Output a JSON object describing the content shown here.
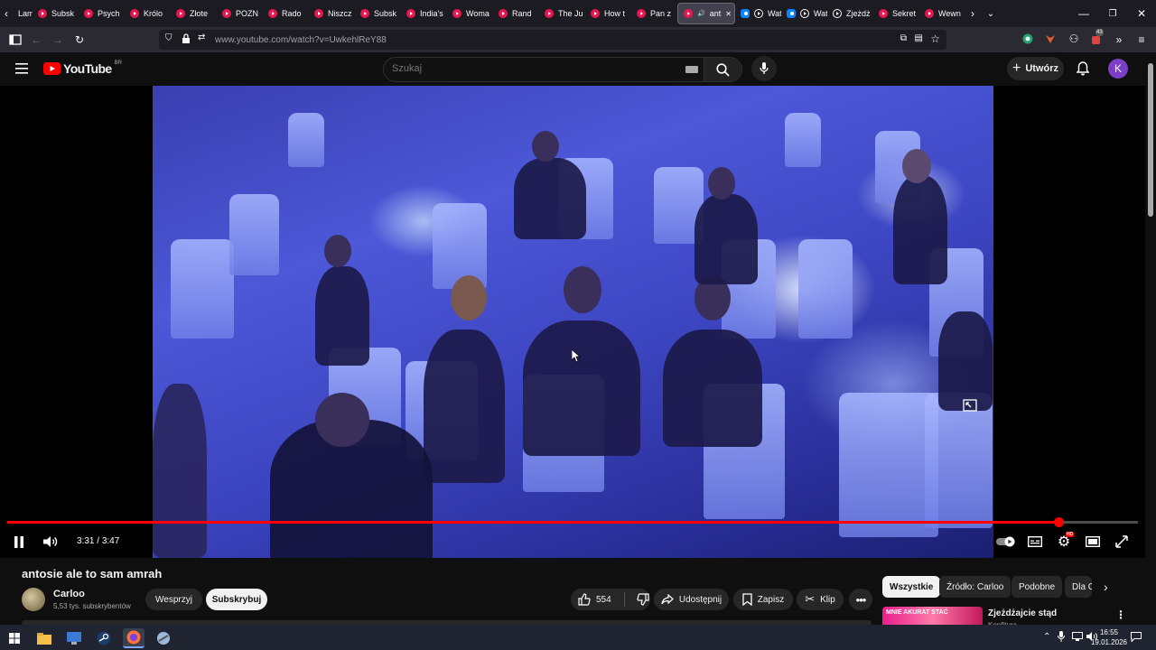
{
  "browser": {
    "tabs": [
      {
        "label": "Lamm"
      },
      {
        "label": "Subsk"
      },
      {
        "label": "Psych"
      },
      {
        "label": "Królo"
      },
      {
        "label": "Złote"
      },
      {
        "label": "POZN"
      },
      {
        "label": "Rado"
      },
      {
        "label": "Niszcz"
      },
      {
        "label": "Subsk"
      },
      {
        "label": "India's"
      },
      {
        "label": "Woma"
      },
      {
        "label": "Rand"
      },
      {
        "label": "The Ju"
      },
      {
        "label": "How t"
      },
      {
        "label": "Pan z"
      },
      {
        "label": "ant"
      },
      {
        "label": "Watch"
      },
      {
        "label": "Watch"
      },
      {
        "label": "Zjeżdż"
      },
      {
        "label": "Sekret"
      },
      {
        "label": "Wewn"
      }
    ],
    "url": "www.youtube.com/watch?v=UwkehlReY88",
    "extension_badge": "43"
  },
  "youtube": {
    "logo_text": "YouTube",
    "logo_suffix": "BR",
    "search_placeholder": "Szukaj",
    "create_label": "Utwórz",
    "avatar_letter": "K"
  },
  "player": {
    "current_time": "3:31",
    "duration": "3:47",
    "time_separator": "/",
    "progress": 0.93,
    "settings_badge": "HD"
  },
  "video": {
    "title": "antosie ale to sam amrah",
    "channel": "Carloo",
    "subscribers": "5,53 tys. subskrybentów",
    "support_label": "Wesprzyj",
    "subscribe_label": "Subskrybuj",
    "likes": "554",
    "share_label": "Udostępnij",
    "save_label": "Zapisz",
    "clip_label": "Klip"
  },
  "sidebar": {
    "chips": [
      "Wszystkie",
      "Źródło: Carloo",
      "Podobne",
      "Dla C"
    ],
    "recommendation": {
      "thumb_text": "MNIE AKURAT STAĆ",
      "title": "Zjeżdżajcie stąd",
      "channel": "Konfitura"
    }
  },
  "taskbar": {
    "time": "16:55",
    "date": "19.01.2026"
  }
}
